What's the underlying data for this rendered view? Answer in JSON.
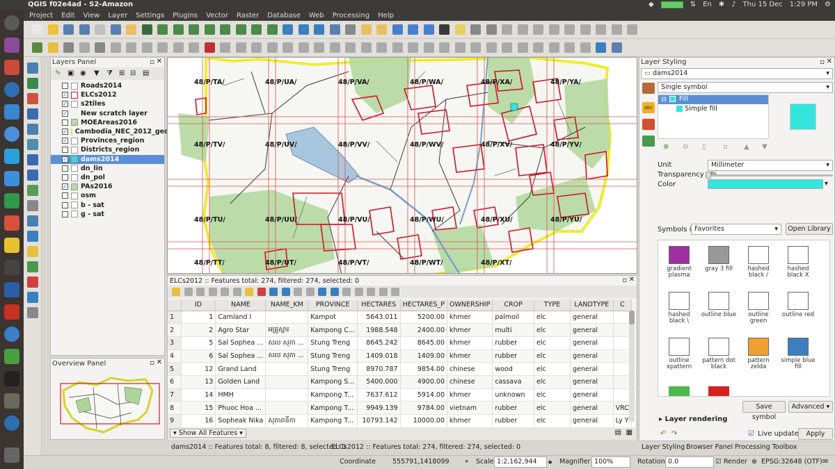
{
  "system": {
    "window_title": "QGIS f02e4ad - S2-Amazon",
    "keyboard": "En",
    "date": "Thu 15 Dec",
    "time": "1:29 PM"
  },
  "menu": [
    "Project",
    "Edit",
    "View",
    "Layer",
    "Settings",
    "Plugins",
    "Vector",
    "Raster",
    "Database",
    "Web",
    "Processing",
    "Help"
  ],
  "layers_panel": {
    "title": "Layers Panel",
    "layers": [
      {
        "name": "Roads2014",
        "checked": false,
        "swatch": "#ffffff"
      },
      {
        "name": "ELCs2012",
        "checked": true,
        "swatch": "#ffffff",
        "border": "#cc1122"
      },
      {
        "name": "s2tiles",
        "checked": true,
        "swatch": "#ffffff"
      },
      {
        "name": "New scratch layer",
        "checked": true,
        "swatch": ""
      },
      {
        "name": "MOEAreas2016",
        "checked": false,
        "swatch": "#b7d8a5"
      },
      {
        "name": "Cambodia_NEC_2012_geo",
        "checked": true,
        "swatch": "#ffffff",
        "border": "#e8e35a"
      },
      {
        "name": "Provinces_region",
        "checked": true,
        "swatch": "#ffffff"
      },
      {
        "name": "Districts_region",
        "checked": false,
        "swatch": "#ffffff"
      },
      {
        "name": "dams2014",
        "checked": true,
        "swatch": "#33ddd5"
      },
      {
        "name": "dn_lin",
        "checked": false,
        "swatch": "#ffffff"
      },
      {
        "name": "dn_pol",
        "checked": false,
        "swatch": "#ffffff"
      },
      {
        "name": "PAs2016",
        "checked": true,
        "swatch": "#b7d8a5"
      },
      {
        "name": "osm",
        "checked": false,
        "swatch": "#ffffff"
      },
      {
        "name": "b - sat",
        "checked": false,
        "swatch": "#ffffff"
      },
      {
        "name": "g - sat",
        "checked": false,
        "swatch": "#ffffff"
      }
    ],
    "selected": "dams2014"
  },
  "overview": {
    "title": "Overview Panel"
  },
  "map": {
    "tiles": [
      "48/P/TA/",
      "48/P/UA/",
      "48/P/VA/",
      "48/P/WA/",
      "48/P/XA/",
      "48/P/YA/",
      "48/P/TV/",
      "48/P/UV/",
      "48/P/VV/",
      "48/P/WV/",
      "48/P/XV/",
      "48/P/YV/",
      "48/P/TU/",
      "48/P/UU/",
      "48/P/VU/",
      "48/P/WU/",
      "48/P/XU/",
      "48/P/YU/",
      "48/P/TT/",
      "48/P/UT/",
      "48/P/VT/",
      "48/P/WT/",
      "48/P/XT/"
    ]
  },
  "attribute_table": {
    "title": "ELCs2012 :: Features total: 274, filtered: 274, selected: 0",
    "columns": [
      "ID",
      "NAME",
      "NAME_KM",
      "PROVINCE",
      "HECTARES",
      "HECTARES_P",
      "OWNERSHIP",
      "CROP",
      "TYPE",
      "LANDTYPE",
      "C"
    ],
    "rows": [
      {
        "rn": "1",
        "id": "1",
        "name": "Camland I",
        "name_km": "",
        "province": "Kampot",
        "hectares": "5643.011",
        "hectares_p": "5200.00",
        "ownership": "khmer",
        "crop": "palmoil",
        "type": "elc",
        "landtype": "general",
        "c": ""
      },
      {
        "rn": "2",
        "id": "2",
        "name": "Agro Star",
        "name_km": "អគ្រូស្តារ",
        "province": "Kampong C...",
        "hectares": "1988.548",
        "hectares_p": "2400.00",
        "ownership": "khmer",
        "crop": "multi",
        "type": "elc",
        "landtype": "general",
        "c": ""
      },
      {
        "rn": "3",
        "id": "5",
        "name": "Sal Sophea ...",
        "name_km": "សល សុភា ...",
        "province": "Stung Treng",
        "hectares": "8645.242",
        "hectares_p": "8645.00",
        "ownership": "khmer",
        "crop": "rubber",
        "type": "elc",
        "landtype": "general",
        "c": ""
      },
      {
        "rn": "4",
        "id": "6",
        "name": "Sal Sophea ...",
        "name_km": "សល សុភា ...",
        "province": "Stung Treng",
        "hectares": "1409.018",
        "hectares_p": "1409.00",
        "ownership": "khmer",
        "crop": "rubber",
        "type": "elc",
        "landtype": "general",
        "c": ""
      },
      {
        "rn": "5",
        "id": "12",
        "name": "Grand Land",
        "name_km": "",
        "province": "Stung Treng",
        "hectares": "8970.787",
        "hectares_p": "9854.00",
        "ownership": "chinese",
        "crop": "wood",
        "type": "elc",
        "landtype": "general",
        "c": ""
      },
      {
        "rn": "6",
        "id": "13",
        "name": "Golden Land",
        "name_km": "",
        "province": "Kampong S...",
        "hectares": "5400.000",
        "hectares_p": "4900.00",
        "ownership": "chinese",
        "crop": "cassava",
        "type": "elc",
        "landtype": "general",
        "c": ""
      },
      {
        "rn": "7",
        "id": "14",
        "name": "HMH",
        "name_km": "",
        "province": "Kampong T...",
        "hectares": "7637.612",
        "hectares_p": "5914.00",
        "ownership": "khmer",
        "crop": "unknown",
        "type": "elc",
        "landtype": "general",
        "c": ""
      },
      {
        "rn": "8",
        "id": "15",
        "name": "Phuoc Hoa ...",
        "name_km": "",
        "province": "Kampong T...",
        "hectares": "9949.139",
        "hectares_p": "9784.00",
        "ownership": "vietnam",
        "crop": "rubber",
        "type": "elc",
        "landtype": "general",
        "c": "VRC"
      },
      {
        "rn": "9",
        "id": "16",
        "name": "Sopheak Nika",
        "name_km": "សុភាពនីកា",
        "province": "Kampong T...",
        "hectares": "10793.142",
        "hectares_p": "10000.00",
        "ownership": "khmer",
        "crop": "rubber",
        "type": "elc",
        "landtype": "general",
        "c": "Ly Y"
      }
    ],
    "show_all": "Show All Features"
  },
  "bottom_tabs": {
    "dams": "dams2014 :: Features total: 8, filtered: 8, selected: 0",
    "elcs": "ELCs2012 :: Features total: 274, filtered: 274, selected: 0"
  },
  "status": {
    "coordinate_label": "Coordinate",
    "coordinate": "555791,1418099",
    "scale_label": "Scale",
    "scale": "1:2,162,944",
    "magnifier_label": "Magnifier",
    "magnifier": "100%",
    "rotation_label": "Rotation",
    "rotation": "0.0",
    "render_label": "Render",
    "crs": "EPSG:32648 (OTF)"
  },
  "styling": {
    "title": "Layer Styling",
    "layer": "dams2014",
    "renderer": "Single symbol",
    "tree_fill": "Fill",
    "tree_simple_fill": "Simple fill",
    "fill_color": "#33e5dc",
    "unit_label": "Unit",
    "unit_value": "Millimeter",
    "transparency_label": "Transparency 0%",
    "color_label": "Color",
    "symbols_in_label": "Symbols in",
    "symbols_group": "Favorites",
    "open_library": "Open Library",
    "symbols": [
      {
        "label": "gradient plasma",
        "color": "#a030a0"
      },
      {
        "label": "gray 3 fill",
        "color": "#999999"
      },
      {
        "label": "hashed black /",
        "color": "#ffffff"
      },
      {
        "label": "hashed black X",
        "color": "#ffffff"
      },
      {
        "label": "hashed black \\",
        "color": "#ffffff"
      },
      {
        "label": "outline blue",
        "color": "#ffffff"
      },
      {
        "label": "outline green",
        "color": "#ffffff"
      },
      {
        "label": "outline red",
        "color": "#ffffff"
      },
      {
        "label": "outline xpattern",
        "color": "#ffffff"
      },
      {
        "label": "pattern dot black",
        "color": "#ffffff"
      },
      {
        "label": "pattern zelda",
        "color": "#f0a030"
      },
      {
        "label": "simple blue fill",
        "color": "#3a7fc0"
      }
    ],
    "save_symbol": "Save symbol",
    "advanced": "Advanced",
    "layer_rendering": "Layer rendering",
    "live_update": "Live update",
    "apply": "Apply"
  },
  "right_tabs": [
    "Layer Styling",
    "Browser Panel",
    "Processing Toolbox"
  ]
}
